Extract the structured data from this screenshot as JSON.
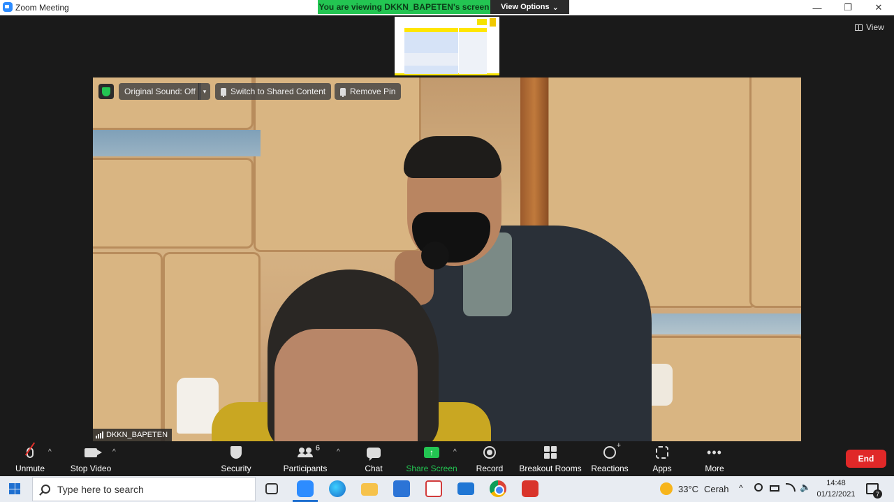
{
  "window": {
    "title": "Zoom Meeting",
    "minimize_glyph": "—",
    "restore_glyph": "❐",
    "close_glyph": "✕"
  },
  "banner": {
    "viewing_text": "You are viewing DKKN_BAPETEN's screen",
    "view_options_label": "View Options",
    "view_options_caret": "⌄"
  },
  "meeting": {
    "view_label": "View"
  },
  "video_overlay": {
    "original_sound_label": "Original Sound: Off",
    "caret_glyph": "▾",
    "switch_label": "Switch to Shared Content",
    "remove_pin_label": "Remove Pin",
    "participant_name": "DKKN_BAPETEN"
  },
  "toolbar": {
    "unmute_label": "Unmute",
    "stop_video_label": "Stop Video",
    "security_label": "Security",
    "participants_label": "Participants",
    "participants_count": "6",
    "chat_label": "Chat",
    "share_screen_label": "Share Screen",
    "share_glyph": "↑",
    "record_label": "Record",
    "breakout_label": "Breakout Rooms",
    "reactions_label": "Reactions",
    "apps_label": "Apps",
    "more_label": "More",
    "more_glyph": "•••",
    "end_label": "End",
    "caret_glyph": "^"
  },
  "taskbar": {
    "search_placeholder": "Type here to search",
    "weather_temp": "33°C",
    "weather_desc": "Cerah",
    "tray_chevron": "^",
    "volume_glyph": "🔈",
    "time": "14:48",
    "date": "01/12/2021",
    "notification_count": "7"
  },
  "colors": {
    "banner_green": "#23c552",
    "end_red": "#e02828",
    "zoom_blue": "#2d8cff",
    "slide_yellow": "#f5e300"
  },
  "icons": {
    "start": "windows-start-icon",
    "search": "search-icon",
    "mic_muted": "microphone-muted-icon",
    "camera": "video-camera-icon",
    "security": "shield-icon",
    "participants": "people-icon",
    "chat": "chat-bubble-icon",
    "share": "share-screen-icon",
    "record": "record-icon",
    "rooms": "breakout-rooms-icon",
    "reactions": "emoji-icon",
    "apps": "apps-icon",
    "more": "more-dots-icon"
  }
}
